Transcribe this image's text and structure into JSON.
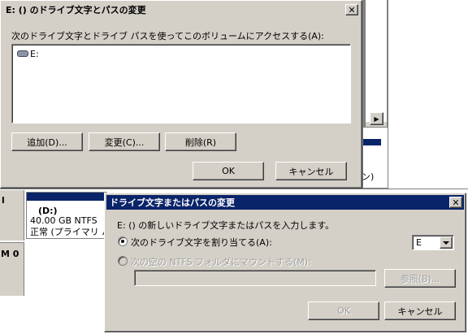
{
  "background_window": {
    "scroll_arrow": "▶",
    "vol_top_right": "ン)",
    "disk_label_top": "l",
    "disk_label_bottom": "M 0",
    "volume": {
      "name": "(D:)",
      "size": "40.00 GB NTFS",
      "status": "正常 (プライマリ パ"
    }
  },
  "dialog_paths": {
    "title": "E: () のドライブ文字とパスの変更",
    "close": "✕",
    "instruction": "次のドライブ文字とドライブ パスを使ってこのボリュームにアクセスする(A):",
    "list_items": [
      {
        "label": "E:",
        "icon": "drive-icon"
      }
    ],
    "add_button": "追加(D)...",
    "change_button": "変更(C)...",
    "remove_button": "削除(R)",
    "ok_button": "OK",
    "cancel_button": "キャンセル"
  },
  "dialog_change": {
    "title": "ドライブ文字またはパスの変更",
    "close": "✕",
    "instruction": "E: () の新しいドライブ文字またはパスを入力します。",
    "radio_assign": "次のドライブ文字を割り当てる(A):",
    "radio_mount": "次の空の NTFS フォルダにマウントする(M):",
    "drive_letter_value": "E",
    "folder_path_value": "",
    "browse_button": "参照(B)...",
    "ok_button": "OK",
    "cancel_button": "キャンセル"
  },
  "colors": {
    "titlebar_active": "#0a246a",
    "titlebar_inactive": "#d4d0c8",
    "face": "#d4d0c8",
    "volume_header": "#0a246a"
  }
}
